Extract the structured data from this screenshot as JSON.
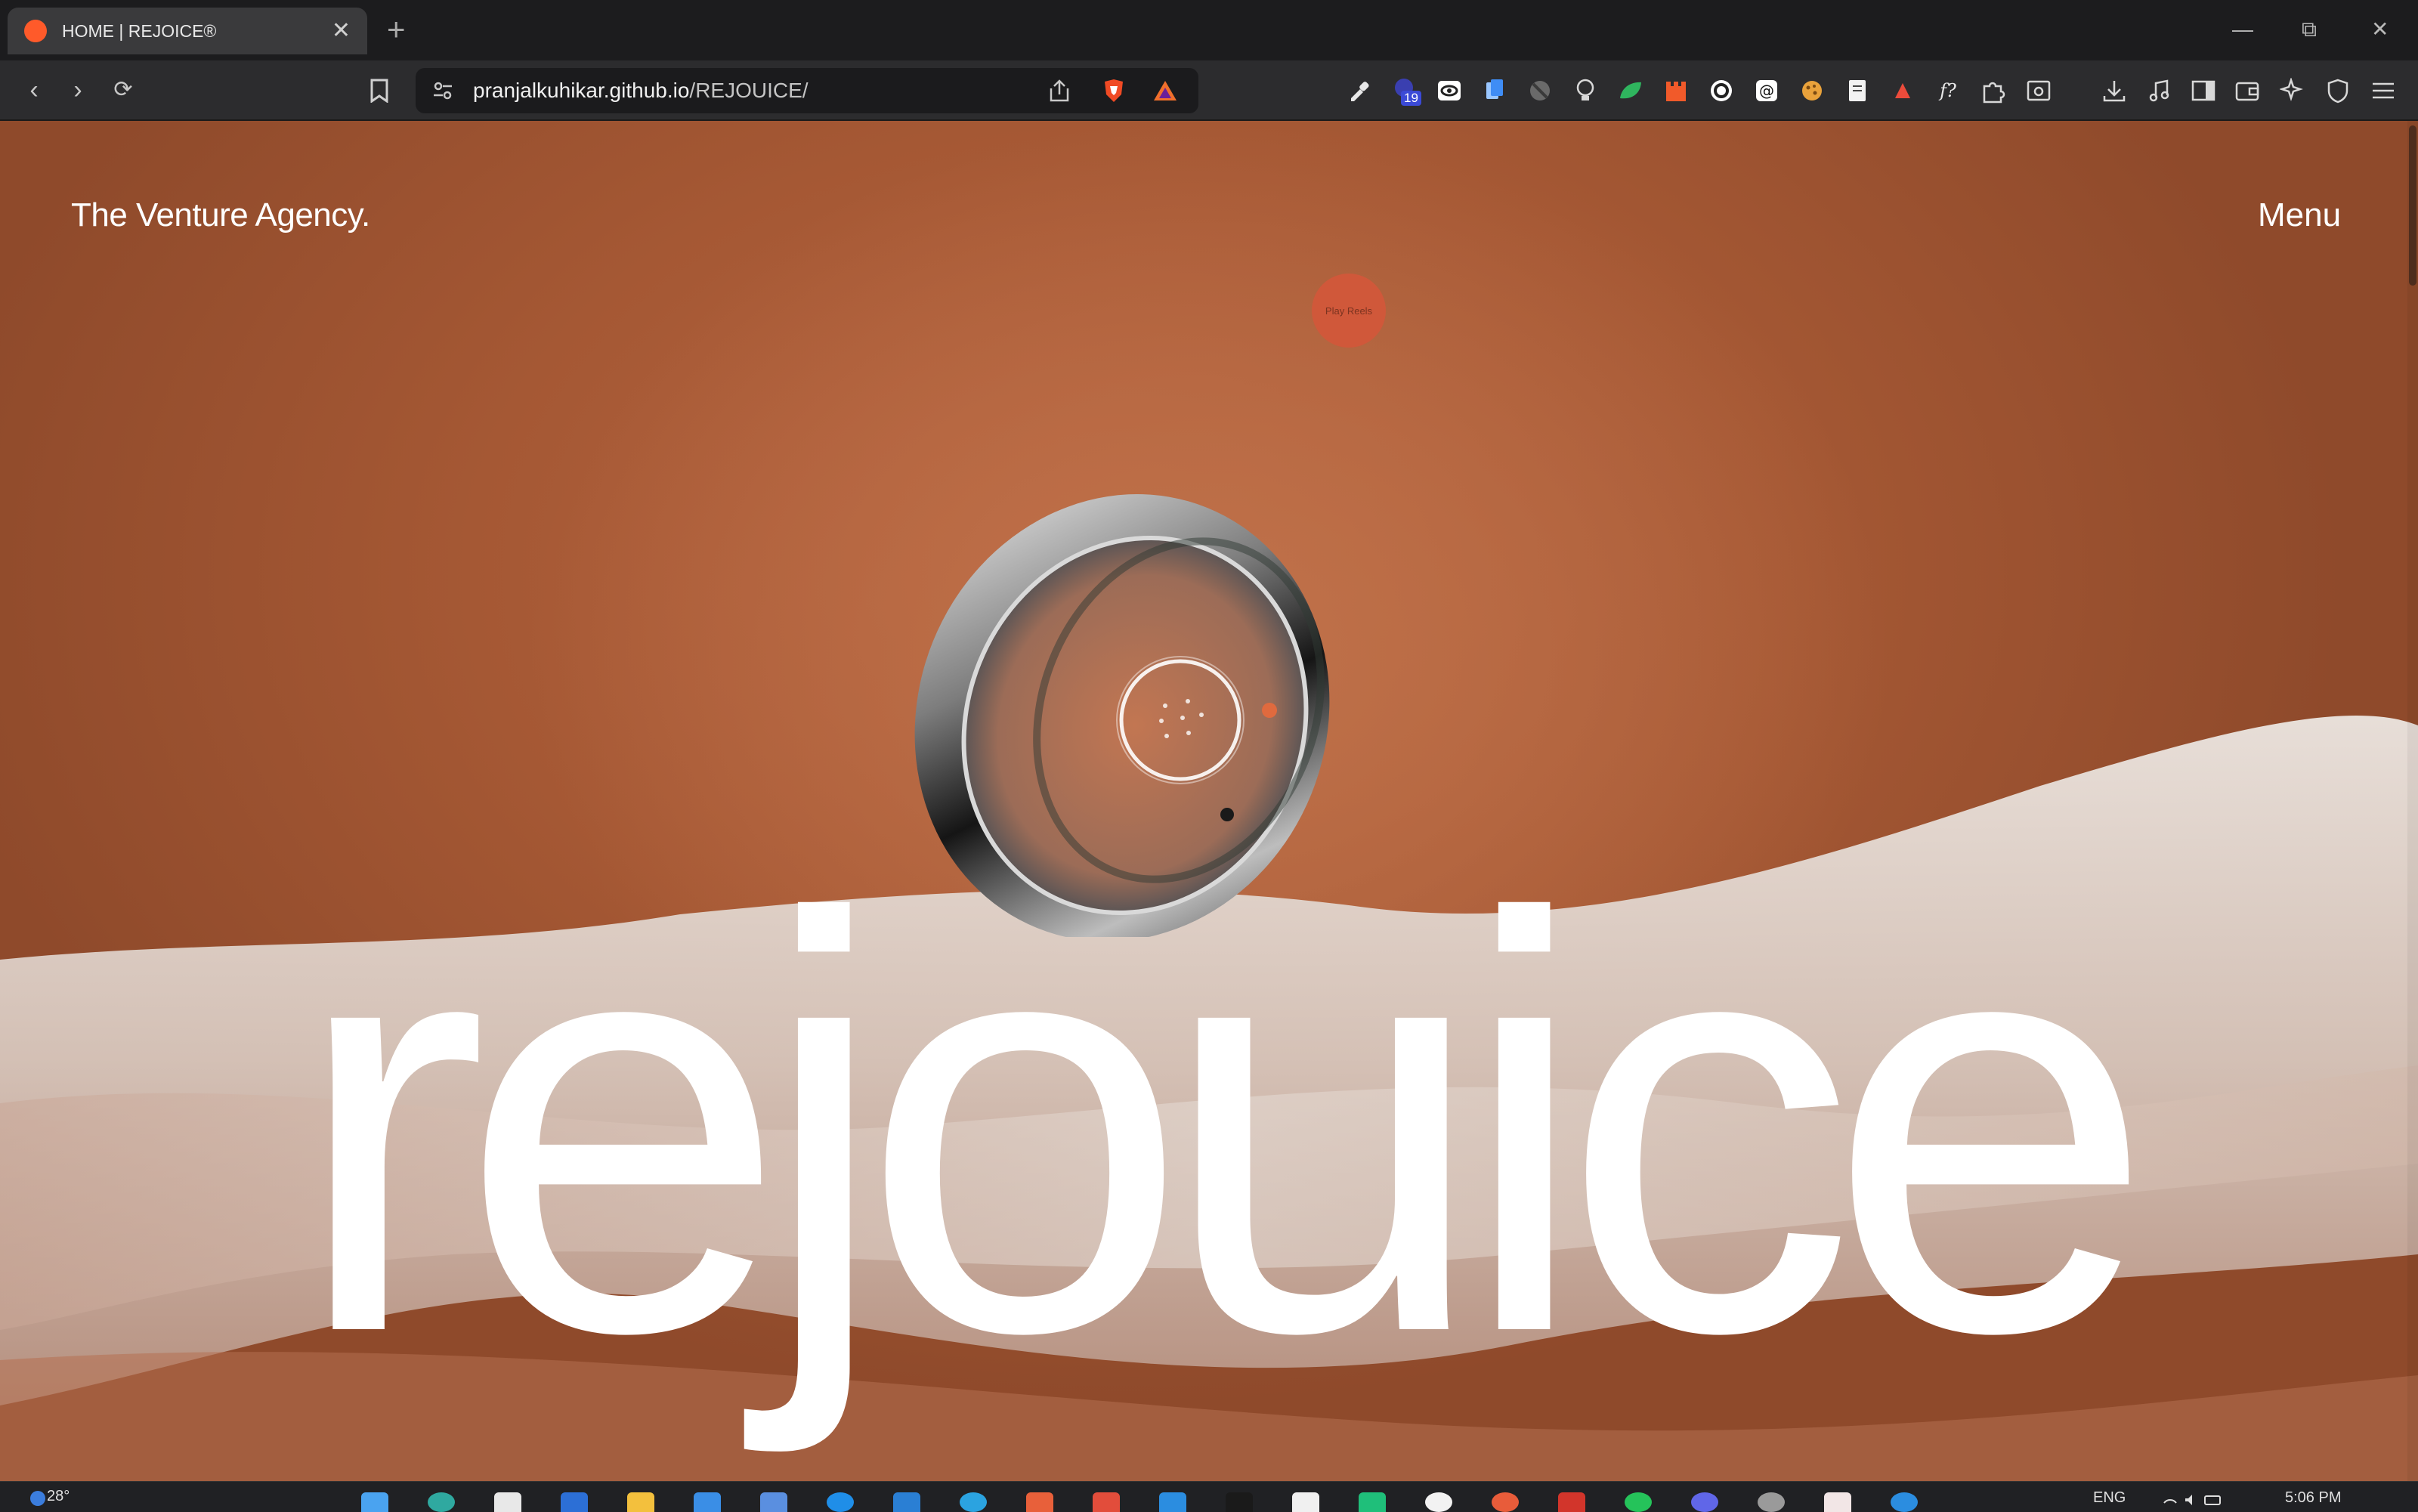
{
  "browser": {
    "tab": {
      "title": "HOME | REJOICE®",
      "close": "✕"
    },
    "new_tab": "+",
    "window_controls": {
      "minimize": "—",
      "restore": "⧉",
      "close": "✕"
    },
    "nav": {
      "back": "‹",
      "forward": "›",
      "reload": "⟳"
    },
    "url": {
      "host": "pranjalkuhikar.github.io",
      "path": "/REJOUICE/"
    },
    "extension_badge": "19"
  },
  "page": {
    "logo": "The Venture Agency.",
    "menu": "Menu",
    "play_reels": "Play Reels",
    "hero_word": "rejouice",
    "colors": {
      "background": "#b3603b",
      "text": "#ffffff",
      "accent": "#d0583a",
      "fabric": "#e9e2dc"
    }
  },
  "taskbar": {
    "temperature": "28°",
    "language": "ENG",
    "time": "5:06 PM"
  },
  "icons": {
    "toolbar": [
      "bookmark-icon",
      "site-settings-icon",
      "share-icon",
      "brave-shields-icon",
      "brave-rewards-icon",
      "eyedropper-icon",
      "extension-icons",
      "extensions-puzzle-icon",
      "downloads-icon",
      "media-icon",
      "sidebar-icon",
      "wallet-icon",
      "leo-ai-icon",
      "vpn-icon",
      "hamburger-menu-icon"
    ]
  }
}
